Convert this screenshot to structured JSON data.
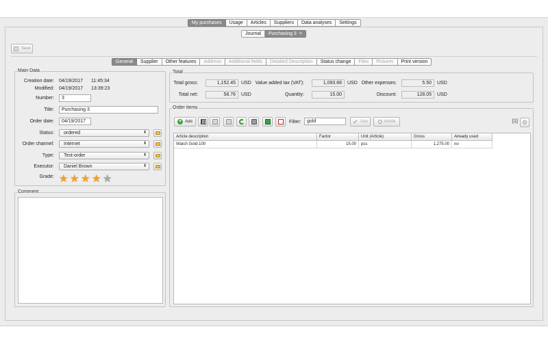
{
  "main_tabs": [
    "My purchases",
    "Usage",
    "Articles",
    "Suppliers",
    "Data analyses",
    "Settings"
  ],
  "sub_tabs": {
    "journal": "Journal",
    "current": "Purchasing 3",
    "close": "×"
  },
  "toolbar": {
    "save_label": "Save"
  },
  "detail_tabs": [
    "General",
    "Supplier",
    "Other features",
    "Address",
    "Additional fields",
    "Detailed Description",
    "Status change",
    "Files",
    "Pictures",
    "Print version"
  ],
  "main_data": {
    "title": "Main Data",
    "creation_label": "Creation date:",
    "creation_date": "04/19/2017",
    "creation_time": "11:45:34",
    "modified_label": "Modified:",
    "modified_date": "04/19/2017",
    "modified_time": "13:39:23",
    "number_label": "Number:",
    "number": "3",
    "title_label": "Title:",
    "title_value": "Purchasing 3",
    "order_date_label": "Order date:",
    "order_date": "04/19/2017",
    "status_label": "Status:",
    "status": "ordered",
    "channel_label": "Order channel:",
    "channel": "Internet",
    "type_label": "Type:",
    "type": "Test-order",
    "executor_label": "Executor:",
    "executor": "Daniel Brown",
    "grade_label": "Grade:",
    "grade_value": 4,
    "grade_max": 5
  },
  "comment": {
    "title": "Comment"
  },
  "total": {
    "title": "Total",
    "gross_label": "Total gross:",
    "gross": "1,152.45",
    "net_label": "Total net:",
    "net": "58.76",
    "vat_label": "Value added tax (VAT):",
    "vat": "1,093.68",
    "quantity_label": "Quantity:",
    "quantity": "15.00",
    "other_label": "Other expenses:",
    "other": "5.50",
    "discount_label": "Discount:",
    "discount": "128.05",
    "currency": "USD"
  },
  "order_items": {
    "title": "Order items",
    "add_label": "Add",
    "filter_label": "Filter:",
    "filter_value": "gold",
    "use_label": "Use",
    "article_label": "Article",
    "count": "[1]",
    "columns": [
      "Article description",
      "Factor",
      "Unit (Article)",
      "Gross",
      "Already used"
    ],
    "rows": [
      [
        "Watch Gold-100",
        "15.00",
        "pcs",
        "1,275.00",
        "no"
      ]
    ]
  }
}
